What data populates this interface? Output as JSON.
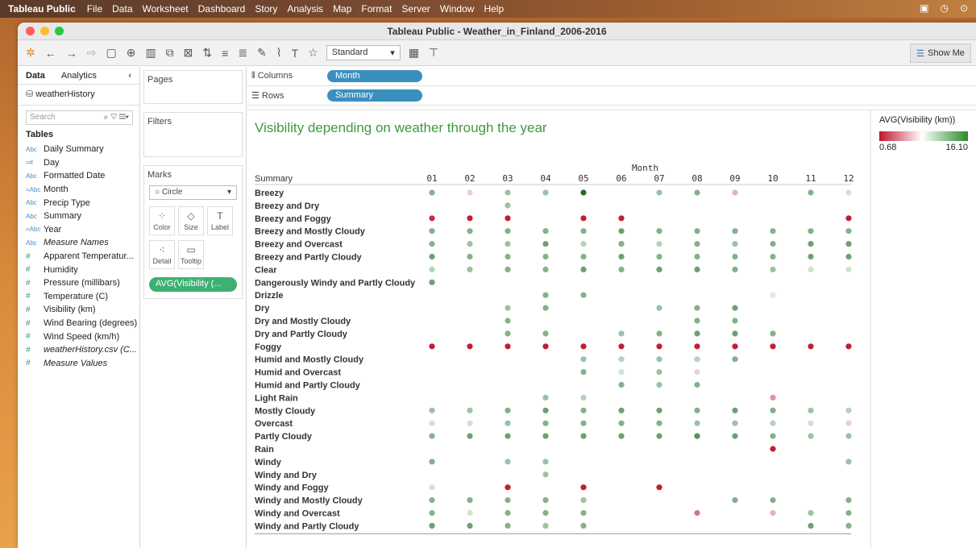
{
  "menubar": {
    "app": "Tableau Public",
    "items": [
      "File",
      "Data",
      "Worksheet",
      "Dashboard",
      "Story",
      "Analysis",
      "Map",
      "Format",
      "Server",
      "Window",
      "Help"
    ]
  },
  "window": {
    "title": "Tableau Public - Weather_in_Finland_2006-2016"
  },
  "toolbar": {
    "fit": "Standard",
    "show_me": "Show Me"
  },
  "left": {
    "tab_data": "Data",
    "tab_analytics": "Analytics",
    "datasource": "weatherHistory",
    "search_placeholder": "Search",
    "tables_heading": "Tables",
    "fields": [
      {
        "type": "Abc",
        "name": "Daily Summary"
      },
      {
        "type": "=#",
        "name": "Day"
      },
      {
        "type": "Abc",
        "name": "Formatted Date"
      },
      {
        "type": "=Abc",
        "name": "Month"
      },
      {
        "type": "Abc",
        "name": "Precip Type"
      },
      {
        "type": "Abc",
        "name": "Summary"
      },
      {
        "type": "=Abc",
        "name": "Year"
      },
      {
        "type": "Abc",
        "name": "Measure Names",
        "italic": true
      },
      {
        "type": "#",
        "name": "Apparent Temperatur..."
      },
      {
        "type": "#",
        "name": "Humidity"
      },
      {
        "type": "#",
        "name": "Pressure (millibars)"
      },
      {
        "type": "#",
        "name": "Temperature (C)"
      },
      {
        "type": "#",
        "name": "Visibility (km)"
      },
      {
        "type": "#",
        "name": "Wind Bearing (degrees)"
      },
      {
        "type": "#",
        "name": "Wind Speed (km/h)"
      },
      {
        "type": "#",
        "name": "weatherHistory.csv (C...",
        "italic": true
      },
      {
        "type": "#",
        "name": "Measure Values",
        "italic": true
      }
    ]
  },
  "cards": {
    "pages": "Pages",
    "filters": "Filters",
    "marks": "Marks",
    "mark_type": "Circle",
    "color": "Color",
    "size": "Size",
    "label": "Label",
    "detail": "Detail",
    "tooltip": "Tooltip",
    "pill": "AVG(Visibility (..."
  },
  "shelves": {
    "columns_label": "Columns",
    "columns_pill": "Month",
    "rows_label": "Rows",
    "rows_pill": "Summary"
  },
  "legend": {
    "title": "AVG(Visibility (km))",
    "min": "0.68",
    "max": "16.10"
  },
  "chart_data": {
    "type": "scatter",
    "title": "Visibility depending on weather through the year",
    "column_header": "Month",
    "row_header": "Summary",
    "columns": [
      "01",
      "02",
      "03",
      "04",
      "05",
      "06",
      "07",
      "08",
      "09",
      "10",
      "11",
      "12"
    ],
    "color_range": [
      0.68,
      16.1
    ],
    "rows": [
      {
        "label": "Breezy",
        "values": [
          12,
          7,
          11,
          11,
          16.1,
          null,
          11,
          12,
          6,
          null,
          12,
          9
        ]
      },
      {
        "label": "Breezy and Dry",
        "values": [
          null,
          null,
          11,
          null,
          null,
          null,
          null,
          null,
          null,
          null,
          null,
          null
        ]
      },
      {
        "label": "Breezy and Foggy",
        "values": [
          1.5,
          1,
          1,
          null,
          1,
          1,
          null,
          null,
          null,
          null,
          null,
          1
        ]
      },
      {
        "label": "Breezy and Mostly Cloudy",
        "values": [
          12,
          12,
          12,
          12,
          12,
          13,
          12,
          12,
          12,
          12,
          12,
          12
        ]
      },
      {
        "label": "Breezy and Overcast",
        "values": [
          12,
          11,
          11,
          13,
          10,
          12,
          10,
          12,
          11,
          12,
          13,
          13
        ]
      },
      {
        "label": "Breezy and Partly Cloudy",
        "values": [
          13,
          12,
          12,
          12,
          12,
          13,
          12,
          12,
          12,
          12,
          13,
          13
        ]
      },
      {
        "label": "Clear",
        "values": [
          10,
          11,
          12,
          12,
          13,
          12,
          13,
          13,
          12,
          11,
          9,
          9
        ]
      },
      {
        "label": "Dangerously Windy and Partly Cloudy",
        "values": [
          13,
          null,
          null,
          null,
          null,
          null,
          null,
          null,
          null,
          null,
          null,
          null
        ]
      },
      {
        "label": "Drizzle",
        "values": [
          null,
          null,
          null,
          12,
          12,
          null,
          null,
          null,
          null,
          8.5,
          null,
          null
        ]
      },
      {
        "label": "Dry",
        "values": [
          null,
          null,
          11,
          12,
          null,
          null,
          11,
          12,
          13,
          null,
          null,
          null
        ]
      },
      {
        "label": "Dry and Mostly Cloudy",
        "values": [
          null,
          null,
          12,
          null,
          null,
          null,
          null,
          12,
          12,
          null,
          null,
          null
        ]
      },
      {
        "label": "Dry and Partly Cloudy",
        "values": [
          null,
          null,
          12,
          12,
          null,
          11,
          12,
          13,
          13,
          12,
          null,
          null
        ]
      },
      {
        "label": "Foggy",
        "values": [
          1,
          1,
          1,
          1,
          1,
          1,
          1,
          1,
          1,
          1,
          1,
          1
        ]
      },
      {
        "label": "Humid and Mostly Cloudy",
        "values": [
          null,
          null,
          null,
          null,
          11,
          10,
          11,
          10,
          12,
          null,
          null,
          null
        ]
      },
      {
        "label": "Humid and Overcast",
        "values": [
          null,
          null,
          null,
          null,
          12,
          9,
          11,
          7,
          null,
          null,
          null,
          null
        ]
      },
      {
        "label": "Humid and Partly Cloudy",
        "values": [
          null,
          null,
          null,
          null,
          null,
          12,
          11,
          12,
          null,
          null,
          null,
          null
        ]
      },
      {
        "label": "Light Rain",
        "values": [
          null,
          null,
          null,
          11,
          10,
          null,
          null,
          null,
          null,
          5,
          null,
          null
        ]
      },
      {
        "label": "Mostly Cloudy",
        "values": [
          11,
          11,
          12,
          13,
          12,
          13,
          13,
          12,
          13,
          12,
          11,
          10
        ]
      },
      {
        "label": "Overcast",
        "values": [
          9,
          9,
          11,
          12,
          12,
          12,
          12,
          11,
          11,
          10,
          9,
          7
        ]
      },
      {
        "label": "Partly Cloudy",
        "values": [
          12,
          13,
          13,
          13,
          13,
          13,
          13,
          14,
          13,
          12,
          11,
          11
        ]
      },
      {
        "label": "Rain",
        "values": [
          null,
          null,
          null,
          null,
          null,
          null,
          null,
          null,
          null,
          1,
          null,
          null
        ]
      },
      {
        "label": "Windy",
        "values": [
          12,
          null,
          11,
          11,
          null,
          null,
          null,
          null,
          null,
          null,
          null,
          11
        ]
      },
      {
        "label": "Windy and Dry",
        "values": [
          null,
          null,
          null,
          11,
          null,
          null,
          null,
          null,
          null,
          null,
          null,
          null
        ]
      },
      {
        "label": "Windy and Foggy",
        "values": [
          9,
          null,
          1,
          null,
          1,
          null,
          1,
          null,
          null,
          null,
          null,
          null
        ]
      },
      {
        "label": "Windy and Mostly Cloudy",
        "values": [
          12,
          12,
          12,
          12,
          11,
          null,
          null,
          null,
          12,
          12,
          null,
          12
        ]
      },
      {
        "label": "Windy and Overcast",
        "values": [
          12,
          9,
          12,
          12,
          12,
          null,
          null,
          4,
          null,
          6,
          11,
          12
        ]
      },
      {
        "label": "Windy and Partly Cloudy",
        "values": [
          13,
          13,
          12,
          11,
          12,
          null,
          null,
          null,
          null,
          null,
          13,
          12
        ]
      }
    ]
  }
}
